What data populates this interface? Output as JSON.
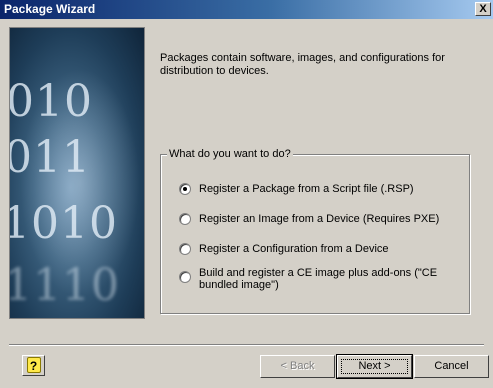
{
  "window": {
    "title": "Package Wizard",
    "close_label": "X"
  },
  "side_image": {
    "digit_rows": [
      "010",
      "011",
      "1010",
      "1110"
    ]
  },
  "intro_text": "Packages contain software, images, and configurations for distribution to devices.",
  "group": {
    "legend": "What do you want to do?",
    "options": [
      {
        "label": "Register a Package from a Script file (.RSP)",
        "checked": true
      },
      {
        "label": "Register an Image from a Device (Requires PXE)",
        "checked": false
      },
      {
        "label": "Register a Configuration from a Device",
        "checked": false
      },
      {
        "label": "Build and register a CE image plus add-ons (\"CE bundled image\")",
        "checked": false
      }
    ]
  },
  "buttons": {
    "help": "?",
    "back": "< Back",
    "next": "Next >",
    "cancel": "Cancel"
  },
  "colors": {
    "title_bar_start": "#0a246a",
    "title_bar_end": "#a6caf0",
    "dialog_face": "#d4d0c8"
  }
}
